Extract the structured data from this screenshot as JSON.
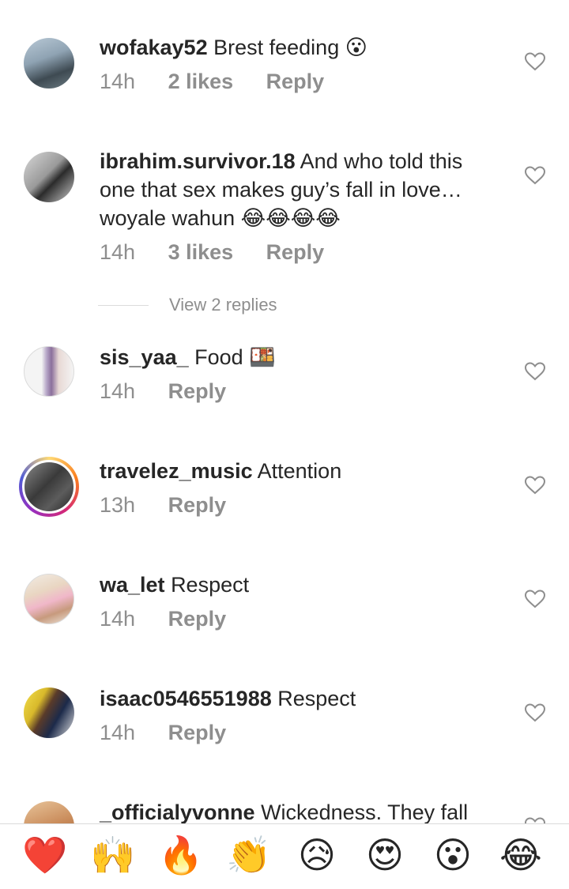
{
  "comments": [
    {
      "username": "wofakay52",
      "text": "Brest feeding",
      "emoji": "😮",
      "time": "14h",
      "likes": "2 likes",
      "reply": "Reply"
    },
    {
      "username": "ibrahim.survivor.18",
      "text": "And who told this one that sex makes guy’s fall in love…woyale wahun",
      "emoji": "😂😂😂😂",
      "time": "14h",
      "likes": "3 likes",
      "reply": "Reply"
    },
    {
      "username": "sis_yaa_",
      "text": "Food",
      "emoji": "🍱",
      "time": "14h",
      "reply": "Reply"
    },
    {
      "username": "travelez_music",
      "text": "Attention",
      "time": "13h",
      "reply": "Reply"
    },
    {
      "username": "wa_let",
      "text": "Respect",
      "time": "14h",
      "reply": "Reply"
    },
    {
      "username": "isaac0546551988",
      "text": "Respect",
      "time": "14h",
      "reply": "Reply"
    },
    {
      "username": "_officialyvonne",
      "text": "Wickedness. They fall"
    }
  ],
  "view_replies": "View 2 replies",
  "reactions": [
    {
      "icon": "heart-emoji",
      "char": "❤️"
    },
    {
      "icon": "raising-hands-emoji",
      "char": "🙌"
    },
    {
      "icon": "fire-emoji",
      "char": "🔥"
    },
    {
      "icon": "clapping-hands-emoji",
      "char": "👏"
    },
    {
      "icon": "sad-face-emoji",
      "char": "😥"
    },
    {
      "icon": "heart-eyes-emoji",
      "char": "😍"
    },
    {
      "icon": "surprised-face-emoji",
      "char": "😮"
    },
    {
      "icon": "laughing-tears-emoji",
      "char": "😂"
    }
  ]
}
